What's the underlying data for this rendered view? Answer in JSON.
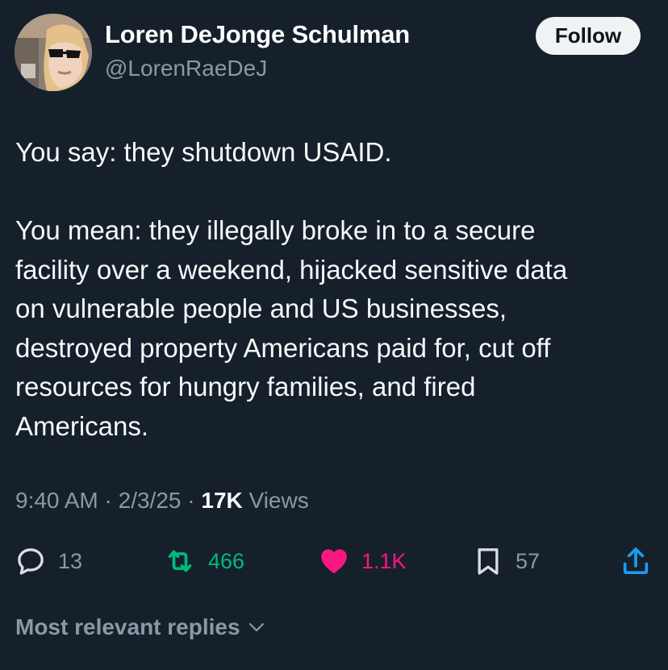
{
  "author": {
    "display_name": "Loren DeJonge Schulman",
    "handle": "@LorenRaeDeJ"
  },
  "follow_button": {
    "label": "Follow"
  },
  "tweet": {
    "paragraph1": [
      "You say: they shutdown USAID."
    ],
    "paragraph2": [
      "You mean: they illegally broke in to a secure",
      "facility over a weekend, hijacked sensitive data",
      "on vulnerable people and US businesses,",
      "destroyed property Americans paid for, cut off",
      "resources for hungry families, and fired",
      "Americans."
    ]
  },
  "meta": {
    "time": "9:40 AM",
    "separator": "·",
    "date": "2/3/25",
    "views_count": "17K",
    "views_label": "Views"
  },
  "actions": {
    "replies": "13",
    "reposts": "466",
    "likes": "1.1K",
    "bookmarks": "57"
  },
  "replies_sort": {
    "label": "Most relevant replies"
  },
  "icons": {
    "reply": "reply-icon",
    "repost": "repost-icon",
    "like": "heart-icon",
    "bookmark": "bookmark-icon",
    "share": "share-icon",
    "chevron": "chevron-down-icon"
  },
  "colors": {
    "background": "#15202b",
    "text": "#f7f9f9",
    "secondary": "#8b98a5",
    "repost": "#00ba7c",
    "like": "#f91880",
    "share": "#1d9bf0",
    "follow_bg": "#eff3f4"
  }
}
